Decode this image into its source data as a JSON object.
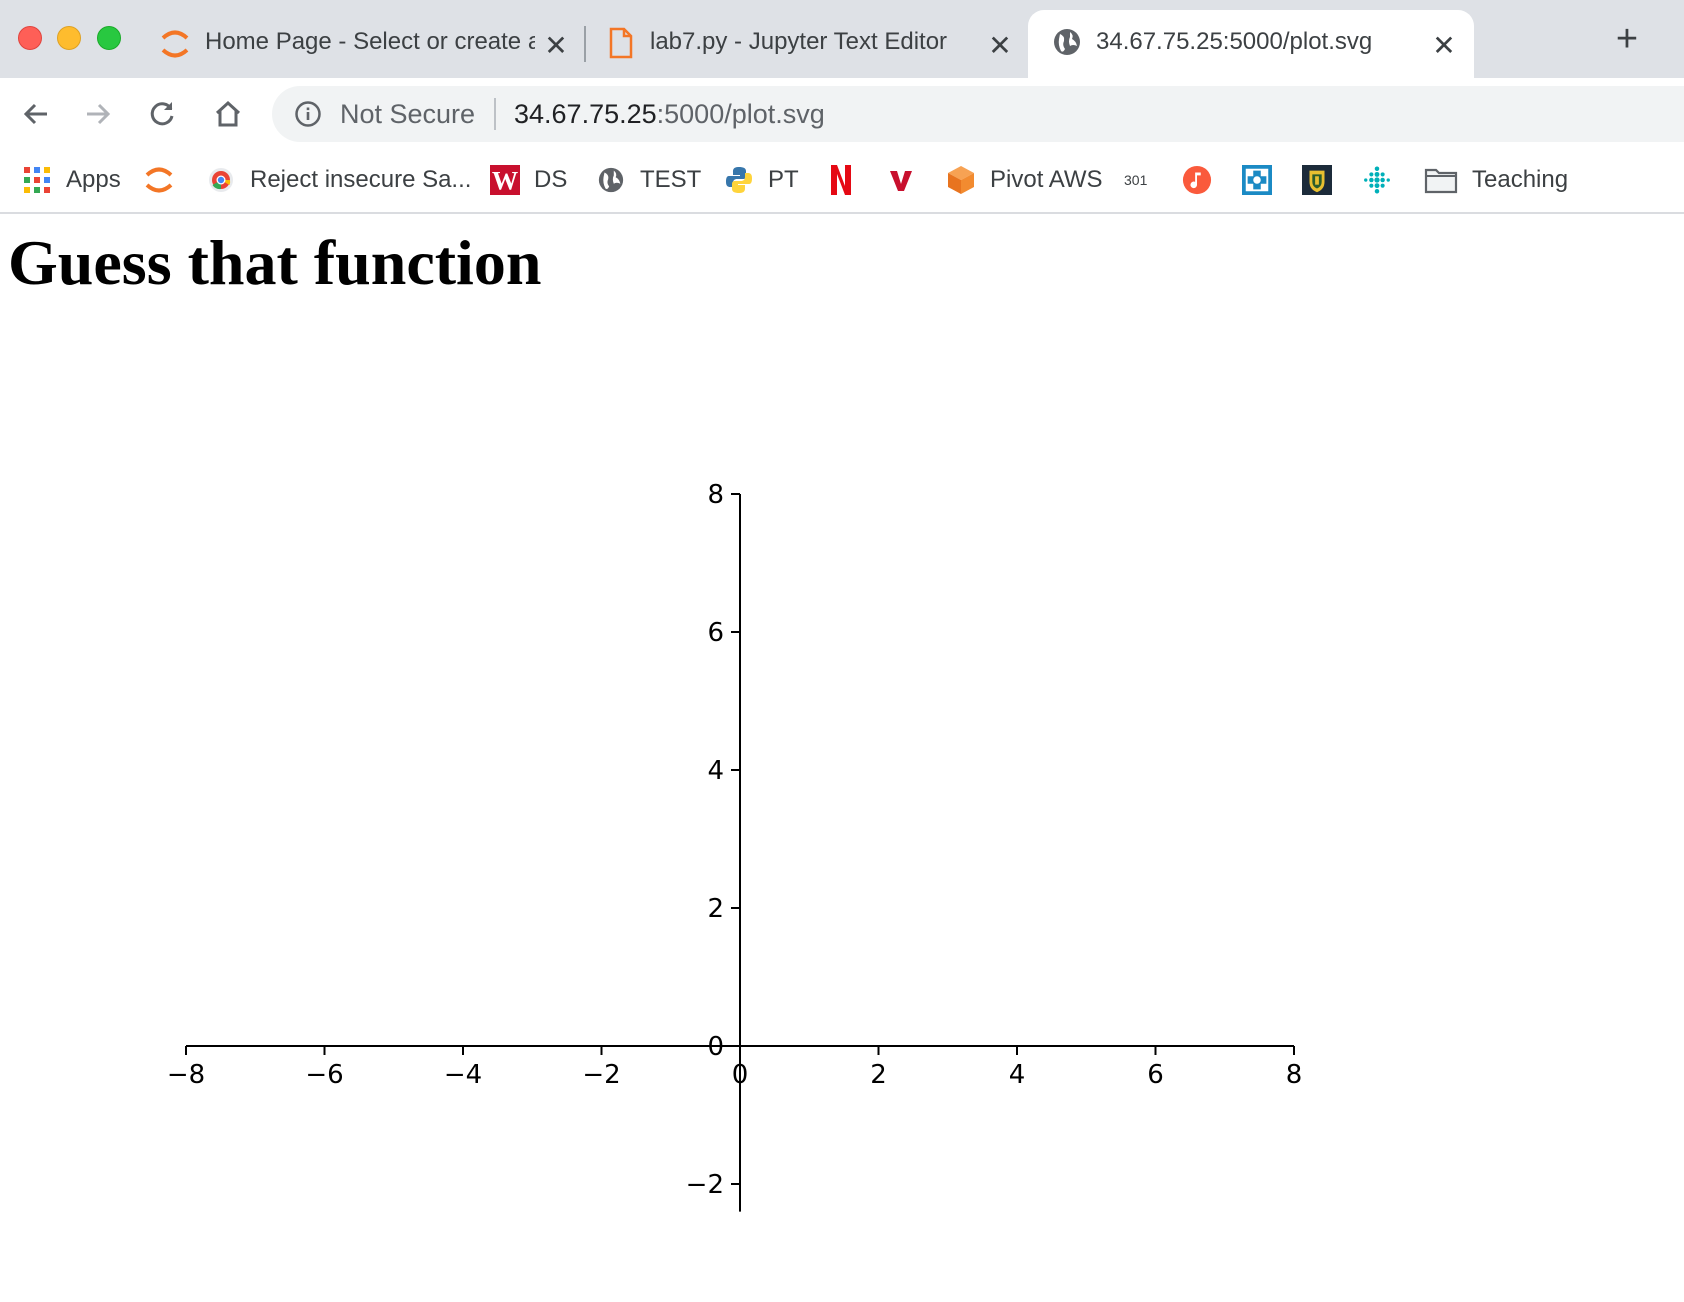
{
  "browser": {
    "tabs": [
      {
        "title": "Home Page - Select or create a n",
        "icon": "jupyter-icon"
      },
      {
        "title": "lab7.py - Jupyter Text Editor",
        "icon": "file-icon"
      },
      {
        "title": "34.67.75.25:5000/plot.svg",
        "icon": "globe-icon",
        "active": true
      }
    ],
    "address_bar": {
      "security_label": "Not Secure",
      "url_host": "34.67.75.25",
      "url_path": ":5000/plot.svg"
    },
    "bookmarks": [
      {
        "label": "Apps",
        "icon": "apps-grid-icon"
      },
      {
        "label": "",
        "icon": "jupyter-icon"
      },
      {
        "label": "Reject insecure Sa...",
        "icon": "chrome-icon"
      },
      {
        "label": "DS",
        "icon": "w-logo-icon"
      },
      {
        "label": "TEST",
        "icon": "globe-icon"
      },
      {
        "label": "PT",
        "icon": "python-icon"
      },
      {
        "label": "",
        "icon": "netflix-icon"
      },
      {
        "label": "",
        "icon": "v-logo-icon"
      },
      {
        "label": "Pivot AWS",
        "icon": "aws-cube-icon"
      },
      {
        "label": "301",
        "icon": "text-badge"
      },
      {
        "label": "",
        "icon": "music-icon"
      },
      {
        "label": "",
        "icon": "medical-cross-icon"
      },
      {
        "label": "",
        "icon": "crest-icon"
      },
      {
        "label": "",
        "icon": "fitbit-icon"
      },
      {
        "label": "Teaching",
        "icon": "folder-icon"
      }
    ],
    "colors": {
      "tabstrip": "#dee1e6",
      "jupyter_orange": "#f37626",
      "netflix_red": "#e50914"
    }
  },
  "page": {
    "title": "Guess that function"
  },
  "chart_data": {
    "type": "line",
    "title": "",
    "xlabel": "",
    "ylabel": "",
    "xlim": [
      -8,
      8
    ],
    "ylim": [
      -2.4,
      8
    ],
    "xticks": [
      -8,
      -6,
      -4,
      -2,
      0,
      2,
      4,
      6,
      8
    ],
    "yticks": [
      -2,
      0,
      2,
      4,
      6,
      8
    ],
    "xtick_labels": [
      "−8",
      "−6",
      "−4",
      "−2",
      "0",
      "2",
      "4",
      "6",
      "8"
    ],
    "ytick_labels": [
      "−2",
      "0",
      "2",
      "4",
      "6",
      "8"
    ],
    "spines": "centered at origin",
    "grid": false,
    "series": []
  }
}
